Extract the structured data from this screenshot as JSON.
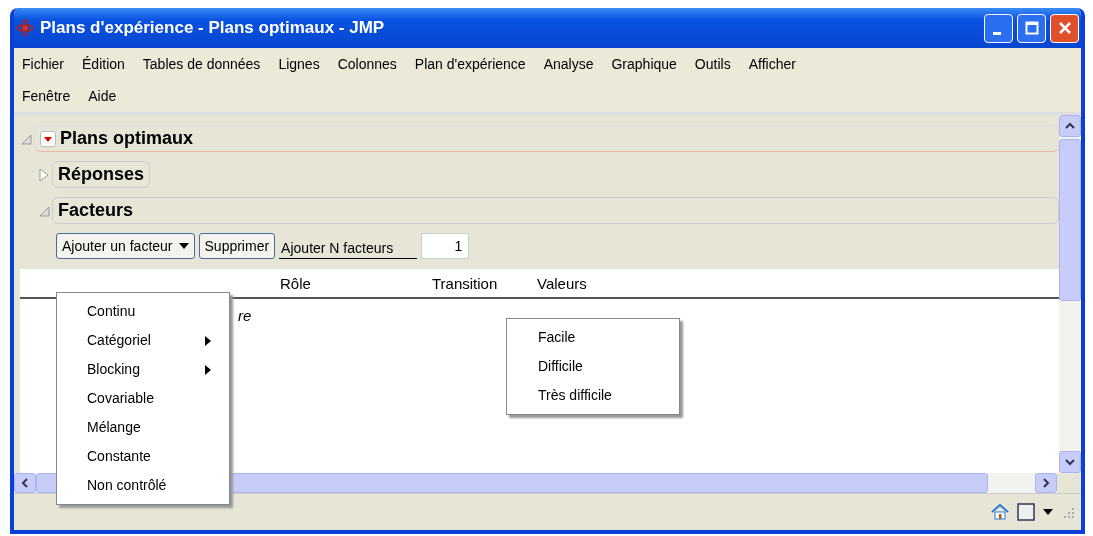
{
  "window": {
    "title": "Plans d'expérience - Plans optimaux - JMP"
  },
  "menu_bar": [
    [
      "Fichier",
      "Édition",
      "Tables de données",
      "Lignes",
      "Colonnes",
      "Plan d'expérience",
      "Analyse",
      "Graphique",
      "Outils",
      "Afficher"
    ],
    [
      "Fenêtre",
      "Aide"
    ]
  ],
  "outline": {
    "title": "Plans optimaux",
    "expanded": true,
    "sections": [
      {
        "title": "Réponses",
        "expanded": false
      },
      {
        "title": "Facteurs",
        "expanded": true
      }
    ]
  },
  "factor_controls": {
    "add_factor_button": "Ajouter un facteur",
    "remove_button": "Supprimer",
    "add_n_label": "Ajouter N facteurs",
    "add_n_value": "1"
  },
  "table": {
    "columns": [
      "Rôle",
      "Transition",
      "Valeurs"
    ],
    "partial_cell": "re"
  },
  "add_factor_menu": [
    {
      "label": "Continu",
      "submenu": false
    },
    {
      "label": "Catégoriel",
      "submenu": true
    },
    {
      "label": "Blocking",
      "submenu": true
    },
    {
      "label": "Covariable",
      "submenu": false
    },
    {
      "label": "Mélange",
      "submenu": false
    },
    {
      "label": "Constante",
      "submenu": false
    },
    {
      "label": "Non contrôlé",
      "submenu": false
    }
  ],
  "transition_menu": [
    "Facile",
    "Difficile",
    "Très difficile"
  ]
}
